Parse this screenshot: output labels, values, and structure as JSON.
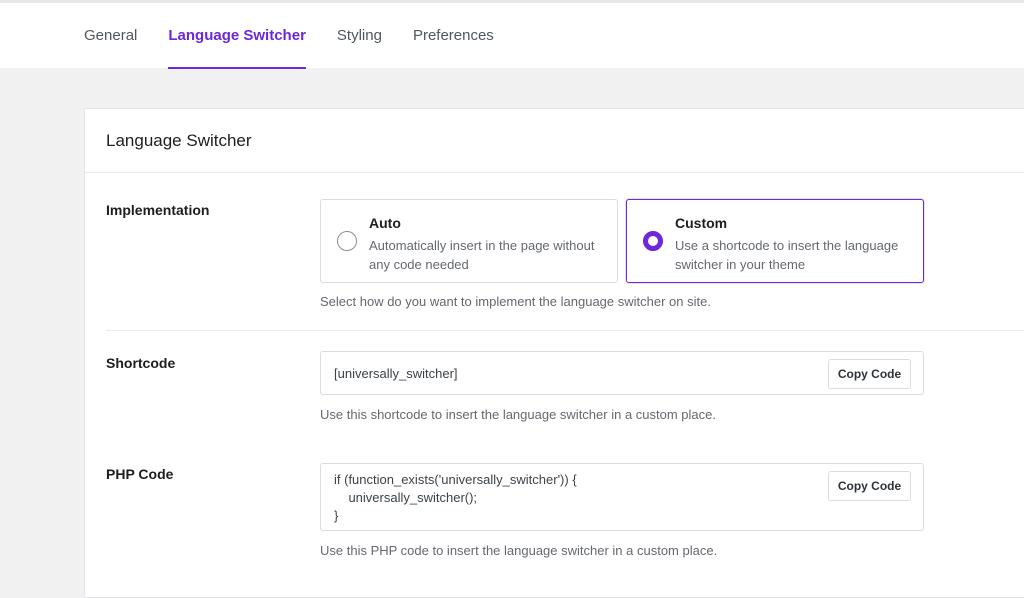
{
  "tabs": [
    {
      "label": "General",
      "active": false
    },
    {
      "label": "Language Switcher",
      "active": true
    },
    {
      "label": "Styling",
      "active": false
    },
    {
      "label": "Preferences",
      "active": false
    }
  ],
  "card": {
    "title": "Language Switcher"
  },
  "implementation": {
    "label": "Implementation",
    "options": [
      {
        "title": "Auto",
        "description": "Automatically insert in the page without any code needed",
        "selected": false
      },
      {
        "title": "Custom",
        "description": "Use a shortcode to insert the language switcher in your theme",
        "selected": true
      }
    ],
    "help": "Select how do you want to implement the language switcher on site."
  },
  "shortcode": {
    "label": "Shortcode",
    "code": "[universally_switcher]",
    "copy_label": "Copy Code",
    "help": "Use this shortcode to insert the language switcher in a custom place."
  },
  "php": {
    "label": "PHP Code",
    "code": "if (function_exists('universally_switcher')) {\n    universally_switcher();\n}",
    "copy_label": "Copy Code",
    "help": "Use this PHP code to insert the language switcher in a custom place."
  },
  "colors": {
    "accent": "#6d28d9",
    "text": "#1e1e1e",
    "muted": "#646970",
    "border": "#dcdcde"
  }
}
